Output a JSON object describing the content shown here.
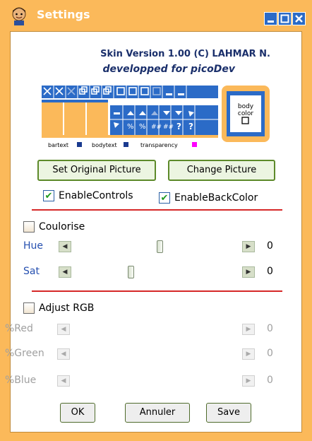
{
  "window": {
    "title": "Settings",
    "title_icon": "user-face-icon",
    "buttons": {
      "minimize": "minimize-icon",
      "maximize": "maximize-icon",
      "close": "close-icon"
    }
  },
  "skin": {
    "version_line": "Skin Version 1.00 (C)  LAHMAR N.",
    "credit_line": "developped for picoDev",
    "preview_labels": {
      "bartext": "bartext",
      "bodytext": "bodytext",
      "transparency": "transparency",
      "body_color": "body\ncolor"
    }
  },
  "buttons": {
    "set_original": "Set Original Picture",
    "change_picture": "Change Picture",
    "ok": "OK",
    "cancel": "Annuler",
    "save": "Save"
  },
  "options": {
    "enable_controls": {
      "label": "EnableControls",
      "checked": true
    },
    "enable_back_color": {
      "label": "EnableBackColor",
      "checked": true
    },
    "colorise": {
      "label": "Coulorise",
      "checked": false
    },
    "adjust_rgb": {
      "label": "Adjust RGB",
      "checked": false
    }
  },
  "colorise_sliders": [
    {
      "label": "Hue",
      "value": "0",
      "position": 0.55
    },
    {
      "label": "Sat",
      "value": "0",
      "position": 0.35
    }
  ],
  "rgb_sliders": [
    {
      "label": "%Red",
      "value": "0"
    },
    {
      "label": "%Green",
      "value": "0"
    },
    {
      "label": "%Blue",
      "value": "0"
    }
  ],
  "colors": {
    "accent": "#fbb95a",
    "title_button": "#2b6bc7",
    "divider": "#d62828",
    "text_blue": "#1a2f6b"
  }
}
